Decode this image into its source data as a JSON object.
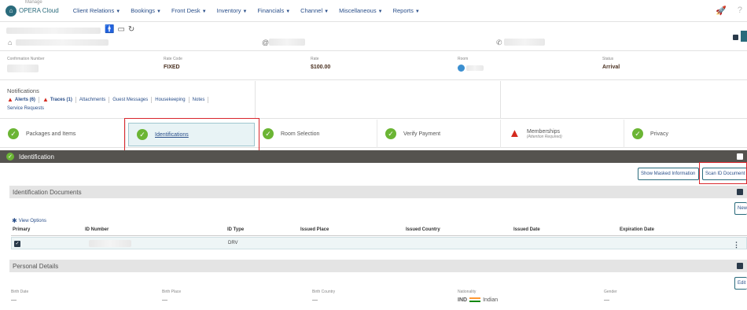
{
  "app": {
    "name": "OPERA Cloud",
    "faded_title": "Manage"
  },
  "nav": {
    "items": [
      "Client Relations",
      "Bookings",
      "Front Desk",
      "Inventory",
      "Financials",
      "Channel",
      "Miscellaneous",
      "Reports"
    ]
  },
  "reservation": {
    "confirmation_label": "Confirmation Number",
    "rate_code_label": "Rate Code",
    "rate_code": "FIXED",
    "rate_label": "Rate",
    "rate": "$100.00",
    "room_label": "Room",
    "status_label": "Status",
    "status": "Arrival"
  },
  "notifications": {
    "title": "Notifications",
    "alerts": "Alerts (6)",
    "traces": "Traces (1)",
    "attachments": "Attachments",
    "guest_messages": "Guest Messages",
    "housekeeping": "Housekeeping",
    "notes": "Notes",
    "service_requests": "Service Requests"
  },
  "steps": [
    {
      "label": "Packages and Items",
      "state": "ok"
    },
    {
      "label": "Identifications",
      "state": "ok",
      "active": true
    },
    {
      "label": "Room Selection",
      "state": "ok"
    },
    {
      "label": "Verify Payment",
      "state": "ok"
    },
    {
      "label": "Memberships",
      "sub": "(Attention Required)",
      "state": "warn"
    },
    {
      "label": "Privacy",
      "state": "ok"
    }
  ],
  "identification": {
    "title": "Identification",
    "show_masked": "Show Masked Information",
    "scan_id": "Scan ID Document",
    "docs_title": "Identification Documents",
    "new_label": "New",
    "view_options": "View Options",
    "columns": [
      "Primary",
      "ID Number",
      "ID Type",
      "Issued Place",
      "Issued Country",
      "Issued Date",
      "Expiration Date"
    ],
    "rows": [
      {
        "primary": true,
        "id_number": "",
        "id_type": "DRV",
        "issued_place": "",
        "issued_country": "",
        "issued_date": "",
        "expiration_date": ""
      }
    ]
  },
  "personal": {
    "title": "Personal Details",
    "edit_label": "Edit",
    "birth_date_label": "Birth Date",
    "birth_date": "—",
    "birth_place_label": "Birth Place",
    "birth_place": "—",
    "birth_country_label": "Birth Country",
    "birth_country": "—",
    "nationality_label": "Nationality",
    "nationality_code": "IND",
    "nationality_name": "Indian",
    "gender_label": "Gender",
    "gender": "—"
  },
  "colors": {
    "brand": "#2a6b7c",
    "link": "#2a4f8a",
    "ok": "#6bb534",
    "alert": "#d42a1e",
    "highlight": "#d9262c"
  }
}
